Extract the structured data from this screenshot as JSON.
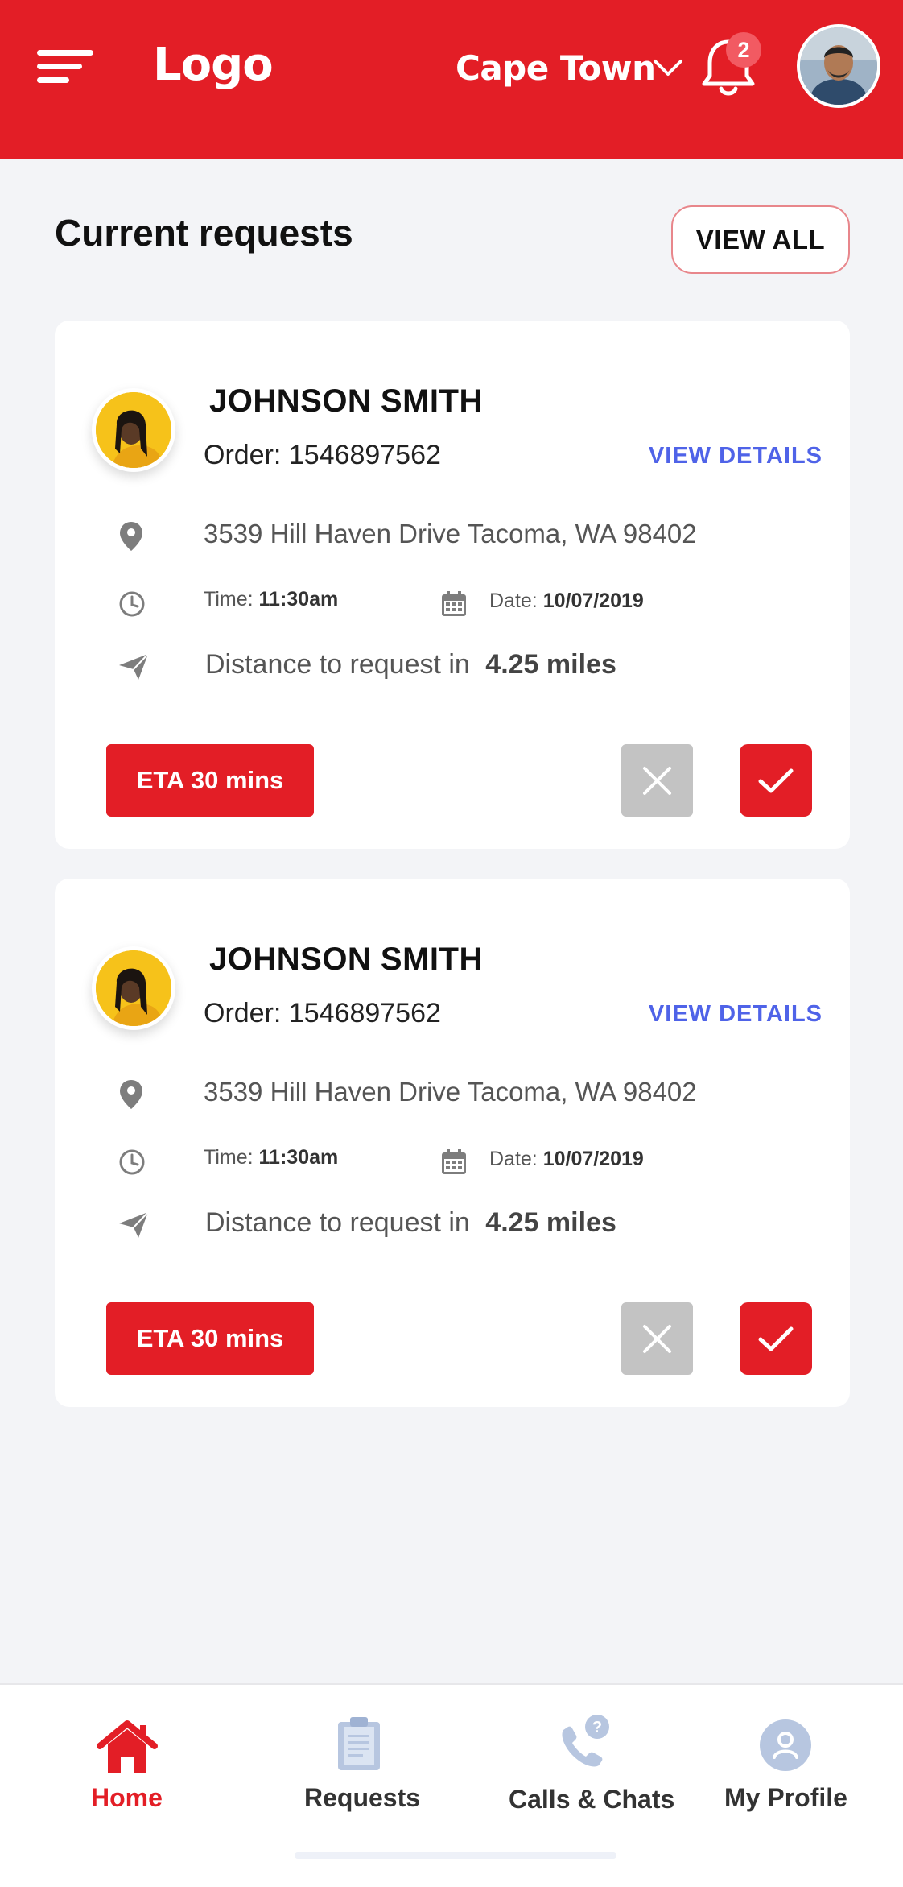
{
  "header": {
    "logo": "Logo",
    "city": "Cape Town",
    "notification_count": "2"
  },
  "section": {
    "title": "Current requests",
    "view_all_label": "VIEW ALL"
  },
  "requests": [
    {
      "name": "JOHNSON SMITH",
      "order": "Order: 1546897562",
      "view_details_label": "VIEW DETAILS",
      "address": "3539 Hill Haven Drive Tacoma, WA 98402",
      "time_label": "Time:",
      "time_value": "11:30am",
      "date_label": "Date:",
      "date_value": "10/07/2019",
      "distance_label": "Distance to request in",
      "distance_value": "4.25 miles",
      "eta_label": "ETA 30 mins"
    },
    {
      "name": "JOHNSON SMITH",
      "order": "Order: 1546897562",
      "view_details_label": "VIEW DETAILS",
      "address": "3539 Hill Haven Drive Tacoma, WA 98402",
      "time_label": "Time:",
      "time_value": "11:30am",
      "date_label": "Date:",
      "date_value": "10/07/2019",
      "distance_label": "Distance to request in",
      "distance_value": "4.25 miles",
      "eta_label": "ETA 30 mins"
    }
  ],
  "bottom_nav": {
    "items": [
      {
        "label": "Home",
        "icon": "home-icon",
        "active": true
      },
      {
        "label": "Requests",
        "icon": "clipboard-icon",
        "active": false
      },
      {
        "label": "Calls & Chats",
        "icon": "phone-question-icon",
        "active": false
      },
      {
        "label": "My Profile",
        "icon": "profile-icon",
        "active": false
      }
    ]
  },
  "colors": {
    "brand_red": "#e31e26",
    "link_blue": "#4f63e8",
    "background": "#f3f4f7",
    "nav_icon_inactive": "#b7c6e0"
  }
}
